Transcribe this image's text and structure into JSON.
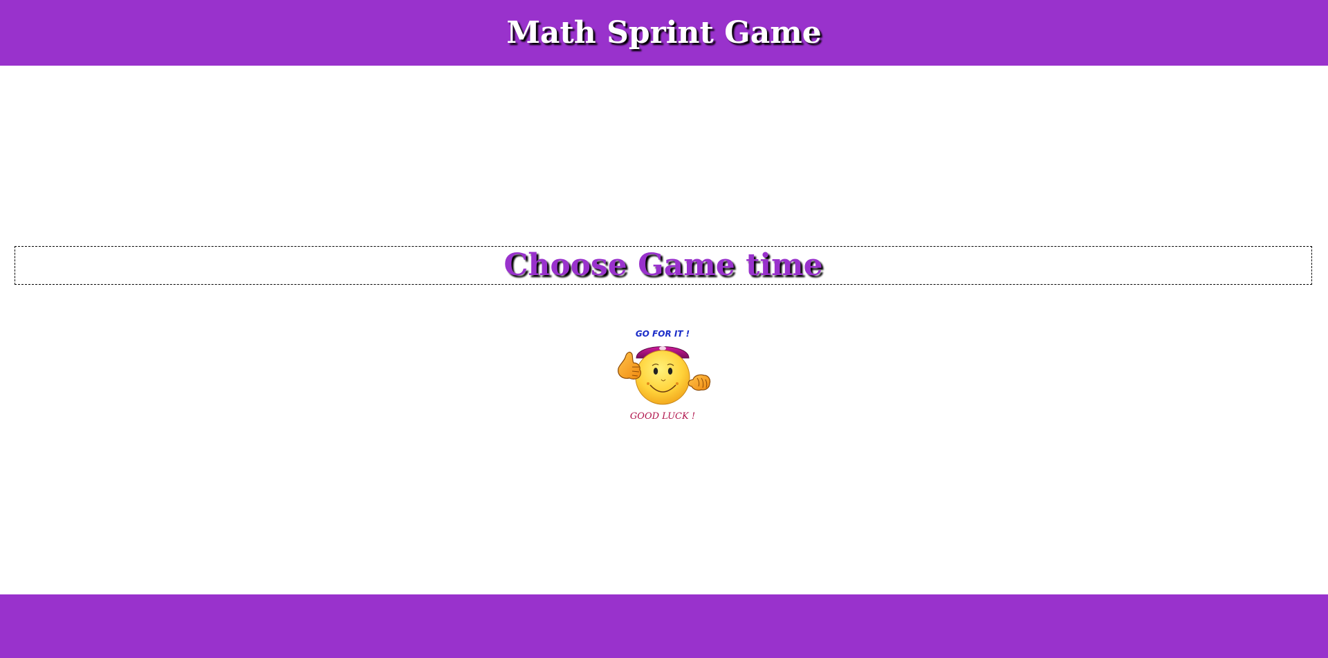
{
  "header": {
    "title": "Math Sprint Game"
  },
  "main": {
    "countdown_text": "Choose Game time",
    "mascot": {
      "top_text": "GO FOR IT !",
      "bottom_text": "GOOD LUCK !"
    }
  },
  "colors": {
    "brand": "#9932cc",
    "background": "#ffffff",
    "text_shadow": "#000000"
  }
}
